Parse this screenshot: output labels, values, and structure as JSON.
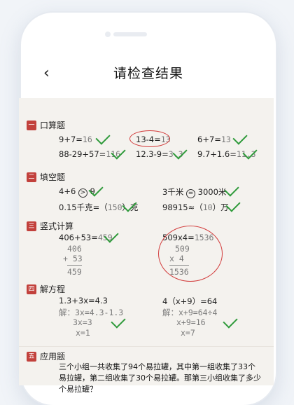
{
  "nav": {
    "back_icon": "chevron-left-icon",
    "title": "请检查结果"
  },
  "sections": [
    {
      "num": "一",
      "label": "口算题",
      "items": [
        {
          "text": "9+7=",
          "answer": "16"
        },
        {
          "text": "13-4=",
          "answer": "13"
        },
        {
          "text": "6+7=",
          "answer": "13"
        },
        {
          "text": "88-29+57=",
          "answer": "116"
        },
        {
          "text": "12.3-9=",
          "answer": "3.3"
        },
        {
          "text": "9.7+1.6=",
          "answer": "11.3"
        }
      ]
    },
    {
      "num": "二",
      "label": "填空题",
      "items": [
        {
          "left": "4+6",
          "symbol": ">",
          "right": "9"
        },
        {
          "left": "3千米",
          "symbol": "=",
          "right": "3000米"
        },
        {
          "text": "0.15千克=（",
          "answer": "150",
          "suffix": "）克"
        },
        {
          "text": "98915≈（",
          "answer": "10",
          "suffix": "）万"
        }
      ]
    },
    {
      "num": "三",
      "label": "竖式计算",
      "items": [
        {
          "text": "406+53=",
          "answer": "459",
          "work": [
            "406",
            "+ 53",
            "459"
          ]
        },
        {
          "text": "509x4=",
          "answer": "1536",
          "work": [
            "509",
            "x    4",
            "1536"
          ]
        }
      ]
    },
    {
      "num": "四",
      "label": "解方程",
      "items": [
        {
          "text": "1.3+3x=4.3",
          "work": [
            "解：3x=4.3-1.3",
            "3x=3",
            "x=1"
          ]
        },
        {
          "text": "4（x+9）=64",
          "work": [
            "解：x+9=64÷4",
            "x+9=16",
            "x=7"
          ]
        }
      ]
    },
    {
      "num": "五",
      "label": "应用题",
      "text": "三个小组一共收集了94个易拉罐，其中第一组收集了33个易拉罐，第二组收集了30个易拉罐。那第三小组收集了多少个易拉罐？"
    }
  ],
  "colors": {
    "accent_red": "#c2413c",
    "check_green": "#2e9a3a",
    "paper": "#f4f2ee"
  }
}
